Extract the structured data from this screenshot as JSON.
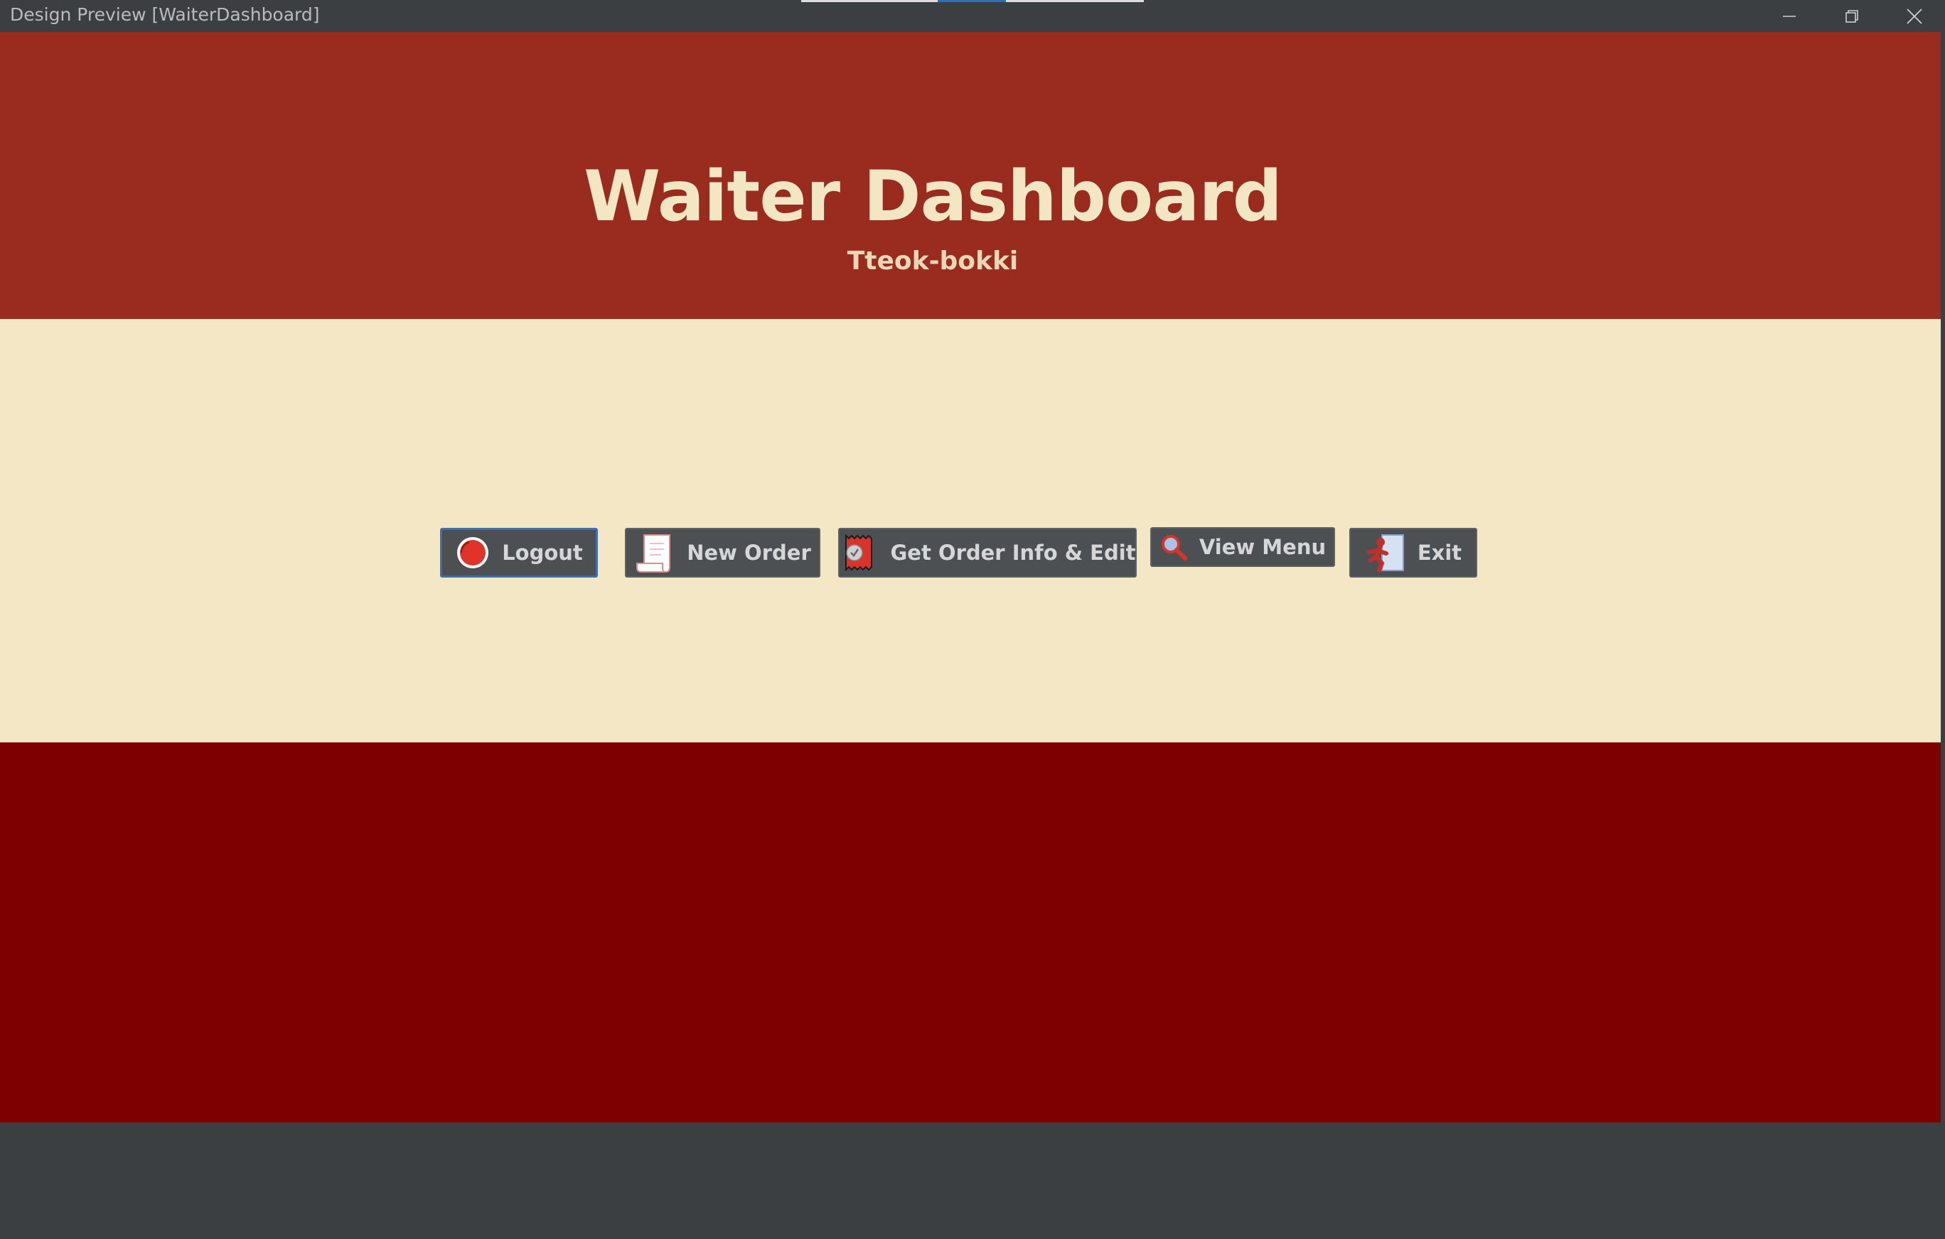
{
  "window": {
    "title": "Design Preview [WaiterDashboard]",
    "controls": [
      "minimize-icon",
      "restore-icon",
      "close-icon"
    ]
  },
  "header": {
    "title": "Waiter Dashboard",
    "subtitle": "Tteok-bokki"
  },
  "buttons": {
    "logout": {
      "label": "Logout",
      "icon": "logout-icon"
    },
    "new_order": {
      "label": "New Order",
      "icon": "receipt-icon"
    },
    "get_order": {
      "label": "Get Order Info & Edit",
      "icon": "order-ticket-icon"
    },
    "view_menu": {
      "label": "View Menu",
      "icon": "search-icon"
    },
    "exit": {
      "label": "Exit",
      "icon": "exit-icon"
    }
  },
  "colors": {
    "header": "#992b1f",
    "middle": "#f3e7c5",
    "footer": "#7f0000",
    "window_chrome": "#3c3f41",
    "button": "#4c5053",
    "title_text": "#f3e6c3"
  }
}
